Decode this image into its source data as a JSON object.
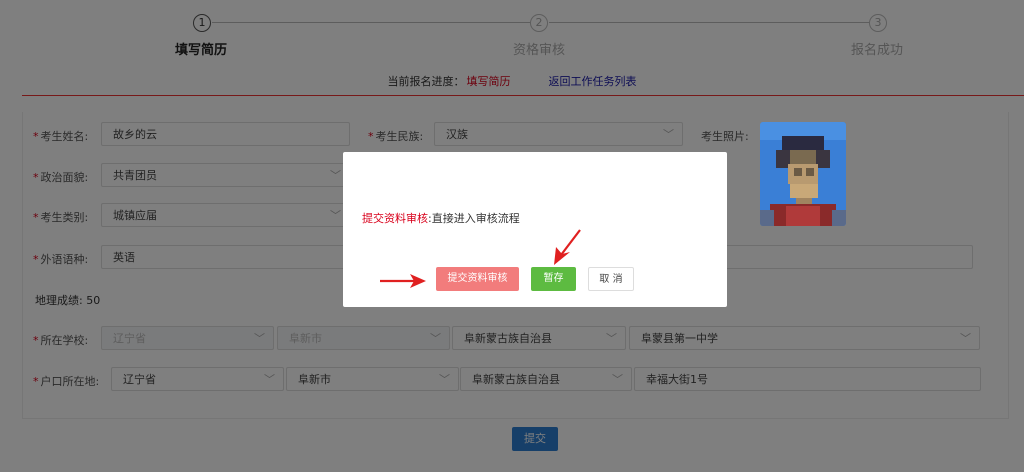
{
  "steps": [
    {
      "num": "1",
      "label": "填写简历",
      "active": true
    },
    {
      "num": "2",
      "label": "资格审核",
      "active": false
    },
    {
      "num": "3",
      "label": "报名成功",
      "active": false
    }
  ],
  "progress": {
    "prefix": "当前报名进度：",
    "current": "填写简历",
    "back_link": "返回工作任务列表"
  },
  "form": {
    "name": {
      "label": "考生姓名:",
      "value": "故乡的云"
    },
    "ethnicity": {
      "label": "考生民族:",
      "value": "汉族"
    },
    "photo": {
      "label": "考生照片:"
    },
    "politics": {
      "label": "政治面貌:",
      "value": "共青团员"
    },
    "category": {
      "label": "考生类别:",
      "value": "城镇应届"
    },
    "language": {
      "label": "外语语种:",
      "value": "英语"
    },
    "geo_score": {
      "label": "地理成绩:",
      "value": "50"
    },
    "school": {
      "label": "所在学校:",
      "province": "辽宁省",
      "city": "阜新市",
      "county": "阜新蒙古族自治县",
      "school": "阜蒙县第一中学"
    },
    "household": {
      "label": "户口所在地:",
      "province": "辽宁省",
      "city": "阜新市",
      "county": "阜新蒙古族自治县",
      "address": "幸福大街1号"
    }
  },
  "submit_label": "提交",
  "modal": {
    "highlight": "提交资料审核",
    "message": ":直接进入审核流程",
    "btn_submit_review": "提交资料审核",
    "btn_save_draft": "暂存",
    "btn_cancel": "取 消"
  },
  "colors": {
    "accent_red": "#d9001b",
    "primary_blue": "#2d7fd3",
    "green": "#5dbb41",
    "pink": "#f27c7c"
  }
}
